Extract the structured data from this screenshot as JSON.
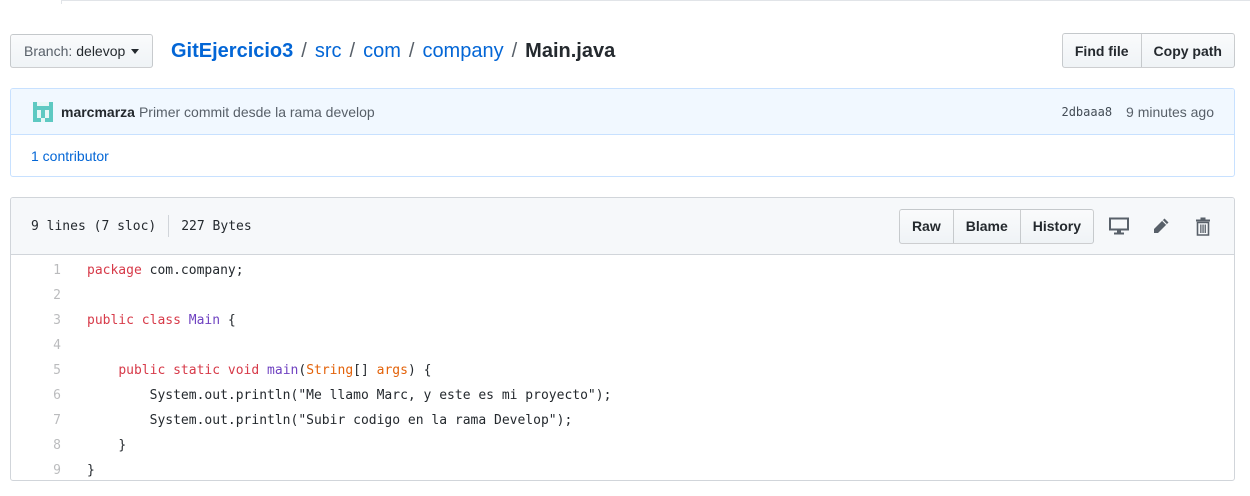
{
  "branch": {
    "prefix": "Branch:",
    "name": "delevop"
  },
  "breadcrumb": {
    "repo": "GitEjercicio3",
    "parts": [
      "src",
      "com",
      "company"
    ],
    "separator": "/",
    "file": "Main.java"
  },
  "path_actions": {
    "find_file": "Find file",
    "copy_path": "Copy path"
  },
  "commit": {
    "author": "marcmarza",
    "message": "Primer commit desde la rama develop",
    "sha": "2dbaaa8",
    "time": "9 minutes ago",
    "contributors": "1 contributor"
  },
  "file": {
    "lines_info": "9 lines (7 sloc)",
    "size": "227 Bytes",
    "raw": "Raw",
    "blame": "Blame",
    "history": "History",
    "icons": [
      "desktop-icon",
      "pencil-icon",
      "trash-icon"
    ]
  },
  "code": {
    "line_numbers": [
      "1",
      "2",
      "3",
      "4",
      "5",
      "6",
      "7",
      "8",
      "9"
    ],
    "l1_kw": "package",
    "l1_rest": " com.company;",
    "l3_kw1": "public",
    "l3_kw2": "class",
    "l3_cls": "Main",
    "l3_rest": " {",
    "l5_kw1": "public",
    "l5_kw2": "static",
    "l5_kw3": "void",
    "l5_fn": "main",
    "l5_p1": "(",
    "l5_tp": "String",
    "l5_p2": "[] ",
    "l5_arg": "args",
    "l5_p3": ") {",
    "l6": "System.out.println(\"Me llamo Marc, y este es mi proyecto\");",
    "l7": "System.out.println(\"Subir codigo en la rama Develop\");",
    "l8": "}",
    "l9": "}"
  },
  "colors": {
    "link": "#0366d6",
    "keyword": "#d73a49",
    "entity": "#6f42c1",
    "param": "#e36209",
    "avatar": "#5ec9c2"
  }
}
